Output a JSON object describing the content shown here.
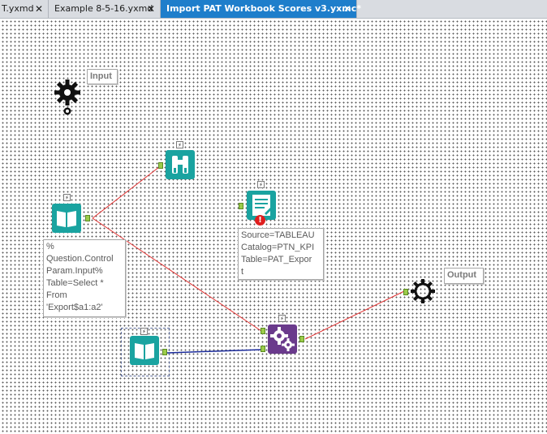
{
  "tabs": [
    {
      "label": "T.yxmd",
      "close": "✕"
    },
    {
      "label": "Example 8-5-16.yxmd",
      "close": "✕"
    },
    {
      "label": "Import PAT Workbook Scores v3.yxmc*",
      "close": "✕"
    }
  ],
  "canvas": {
    "input_label": "Input",
    "output_label": "Output",
    "input_tool_bolt": "⚡",
    "browse_bolt": "⚡",
    "sql_bolt": "⚡",
    "batch_bolt": "⚡",
    "input2_bolt": "⚡",
    "input1_bolt": "⚡",
    "input1_annotation": "%\nQuestion.Control\nParam.Input%\nTable=Select *\nFrom\n'Export$a1:a2'",
    "sql_annotation": "Source=TABLEAU\nCatalog=PTN_KPI\nTable=PAT_Expor\nt",
    "error_badge": "!"
  },
  "colors": {
    "accent": "#1e7ecb",
    "teal_tool": "#1aa3a0",
    "purple_tool": "#6a3a8c",
    "red_wire": "#e03030",
    "blue_wire": "#1a2a9a"
  }
}
